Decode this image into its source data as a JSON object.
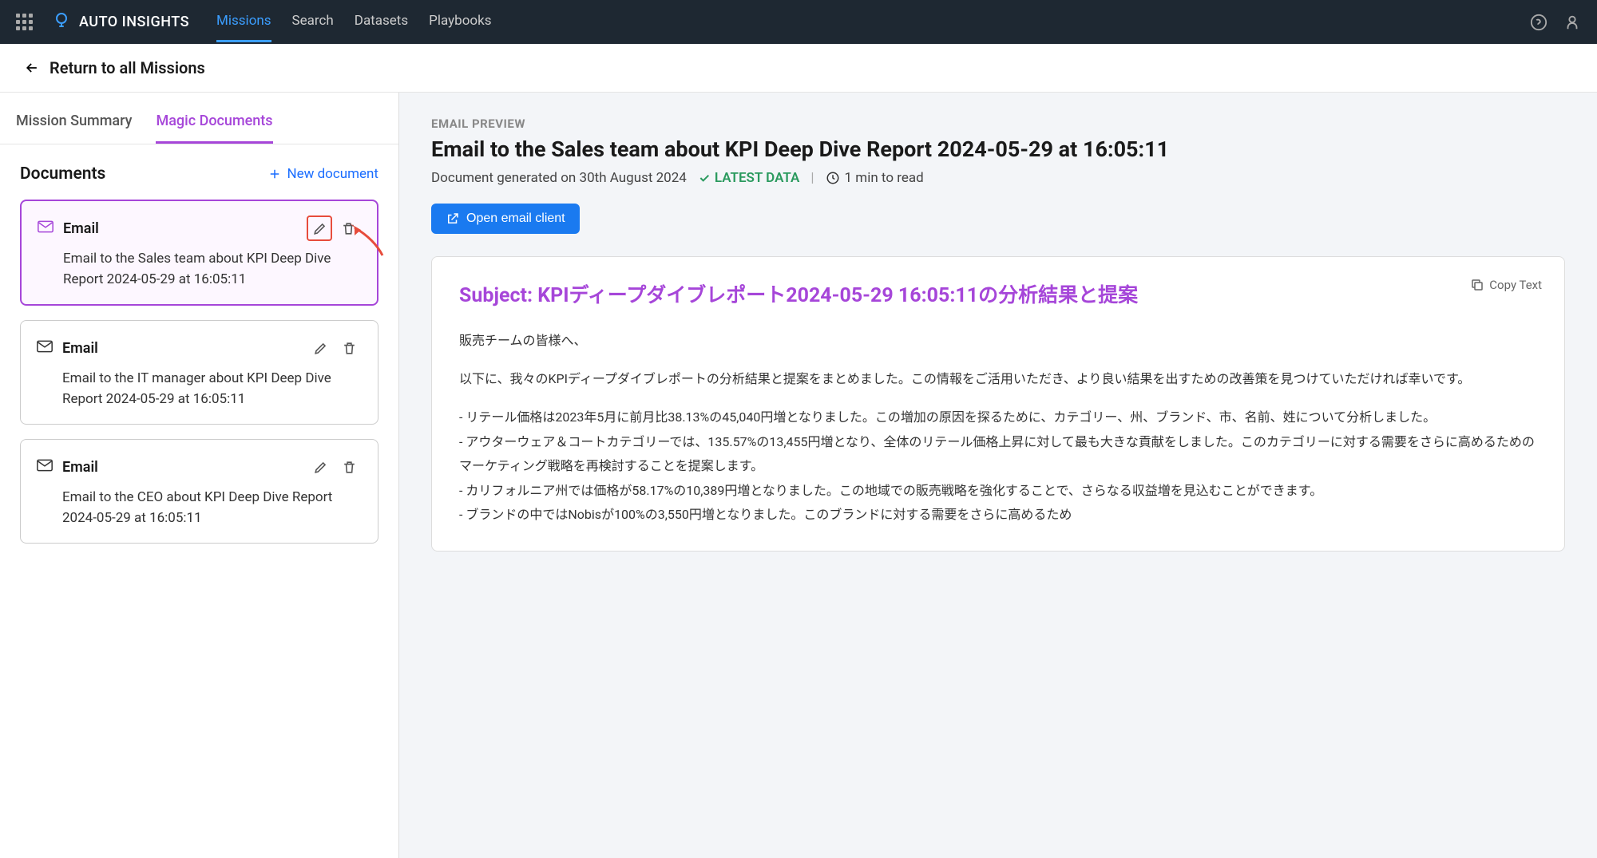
{
  "topbar": {
    "brand": "AUTO INSIGHTS",
    "nav": [
      "Missions",
      "Search",
      "Datasets",
      "Playbooks"
    ],
    "active_nav_index": 0
  },
  "backbar": {
    "label": "Return to all Missions"
  },
  "tabs": {
    "items": [
      "Mission Summary",
      "Magic Documents"
    ],
    "active_index": 1
  },
  "docs": {
    "title": "Documents",
    "new_label": "New document",
    "items": [
      {
        "type": "Email",
        "desc": "Email to the Sales team about KPI Deep Dive Report 2024-05-29 at 16:05:11",
        "selected": true,
        "edit_highlighted": true
      },
      {
        "type": "Email",
        "desc": "Email to the IT manager about KPI Deep Dive Report 2024-05-29 at 16:05:11",
        "selected": false,
        "edit_highlighted": false
      },
      {
        "type": "Email",
        "desc": "Email to the CEO about KPI Deep Dive Report 2024-05-29 at 16:05:11",
        "selected": false,
        "edit_highlighted": false
      }
    ]
  },
  "preview": {
    "label": "EMAIL PREVIEW",
    "title": "Email to the Sales team about KPI Deep Dive Report 2024-05-29 at 16:05:11",
    "generated": "Document generated on 30th August 2024",
    "badge": "LATEST DATA",
    "read_time": "1 min to read",
    "open_button": "Open email client",
    "copy_label": "Copy Text",
    "subject": "Subject: KPIディープダイブレポート2024-05-29 16:05:11の分析結果と提案",
    "greeting": "販売チームの皆様へ、",
    "intro": "以下に、我々のKPIディープダイブレポートの分析結果と提案をまとめました。この情報をご活用いただき、より良い結果を出すための改善策を見つけていただければ幸いです。",
    "bullets": "- リテール価格は2023年5月に前月比38.13%の45,040円増となりました。この増加の原因を探るために、カテゴリー、州、ブランド、市、名前、姓について分析しました。\n- アウターウェア＆コートカテゴリーでは、135.57%の13,455円増となり、全体のリテール価格上昇に対して最も大きな貢献をしました。このカテゴリーに対する需要をさらに高めるためのマーケティング戦略を再検討することを提案します。\n- カリフォルニア州では価格が58.17%の10,389円増となりました。この地域での販売戦略を強化することで、さらなる収益増を見込むことができます。\n- ブランドの中ではNobisが100%の3,550円増となりました。このブランドに対する需要をさらに高めるため"
  }
}
